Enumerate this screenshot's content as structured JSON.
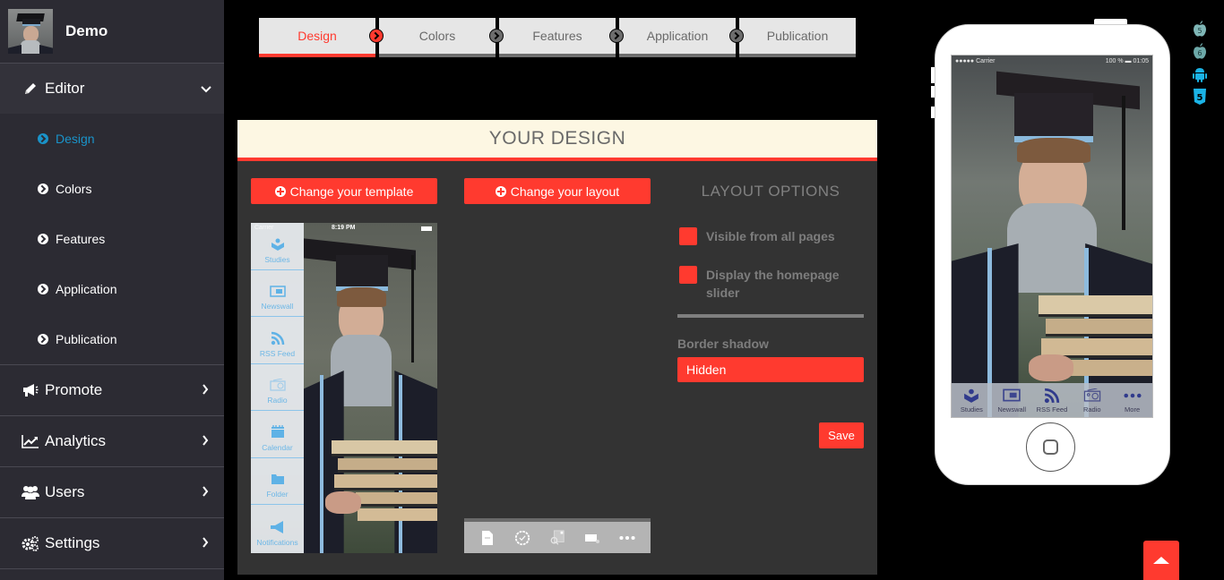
{
  "sidebar": {
    "profile_name": "Demo",
    "editor": {
      "label": "Editor",
      "icon": "pencil-icon",
      "expanded": true
    },
    "sub_items": [
      {
        "label": "Design",
        "active": true
      },
      {
        "label": "Colors",
        "active": false
      },
      {
        "label": "Features",
        "active": false
      },
      {
        "label": "Application",
        "active": false
      },
      {
        "label": "Publication",
        "active": false
      }
    ],
    "sections": [
      {
        "label": "Promote",
        "icon": "megaphone-icon"
      },
      {
        "label": "Analytics",
        "icon": "line-chart-icon"
      },
      {
        "label": "Users",
        "icon": "users-icon"
      },
      {
        "label": "Settings",
        "icon": "gears-icon"
      }
    ]
  },
  "steps": [
    {
      "label": "Design",
      "active": true
    },
    {
      "label": "Colors",
      "active": false
    },
    {
      "label": "Features",
      "active": false
    },
    {
      "label": "Application",
      "active": false
    },
    {
      "label": "Publication",
      "active": false
    }
  ],
  "panel": {
    "title": "YOUR DESIGN",
    "change_template_label": "Change your template",
    "change_layout_label": "Change your layout",
    "layout_options_title": "LAYOUT OPTIONS",
    "options": [
      {
        "label": "Visible from all pages"
      },
      {
        "label": "Display the homepage slider"
      }
    ],
    "border_shadow_label": "Border shadow",
    "border_shadow_value": "Hidden",
    "save_label": "Save",
    "template_preview": {
      "status_carrier": "Carrier",
      "status_time": "8:19 PM",
      "menu_items": [
        "Studies",
        "Newswall",
        "RSS Feed",
        "Radio",
        "Calendar",
        "Folder",
        "Notifications"
      ]
    },
    "layout_preview_icons": [
      "page-icon",
      "badge-icon",
      "search-map-icon",
      "message-icon",
      "more-icon"
    ]
  },
  "phone": {
    "status_carrier": "●●●●● Carrier",
    "status_right": "100 % ▬ 01:05",
    "tabs": [
      {
        "label": "Studies",
        "icon": "reader-icon"
      },
      {
        "label": "Newswall",
        "icon": "newspaper-icon"
      },
      {
        "label": "RSS Feed",
        "icon": "rss-icon"
      },
      {
        "label": "Radio",
        "icon": "radio-icon"
      },
      {
        "label": "More",
        "icon": "more-icon"
      }
    ]
  },
  "platforms": [
    {
      "name": "ios5",
      "label": "5"
    },
    {
      "name": "ios6",
      "label": "6"
    },
    {
      "name": "android",
      "label": ""
    },
    {
      "name": "html5",
      "label": "5"
    }
  ],
  "colors": {
    "accent": "#ff3a2f",
    "sidebar_bg": "#2c2b33",
    "active_sub": "#1a93c9",
    "panel_bg": "#333333",
    "panel_header_bg": "#fdf7e3"
  }
}
